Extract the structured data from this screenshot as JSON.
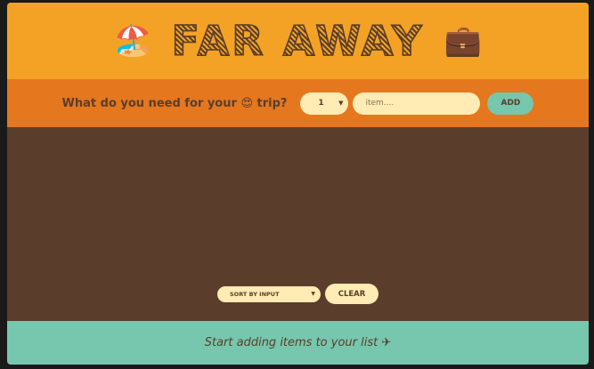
{
  "header": {
    "title": "FAR AWAY",
    "left_icon": "🏖️",
    "right_icon": "💼"
  },
  "form": {
    "question": "What do you need for your",
    "question_emoji": "😍",
    "question_suffix": "trip?",
    "quantity_value": "1",
    "item_placeholder": "item....",
    "add_label": "ADD"
  },
  "actions": {
    "sort_value": "SORT BY INPUT",
    "clear_label": "CLEAR"
  },
  "stats": {
    "text": "Start adding items to your list ✈"
  },
  "colors": {
    "header": "#f4a226",
    "form": "#e5771f",
    "list": "#5a3e2b",
    "stats": "#76c7ad",
    "pill": "#ffebb3"
  }
}
